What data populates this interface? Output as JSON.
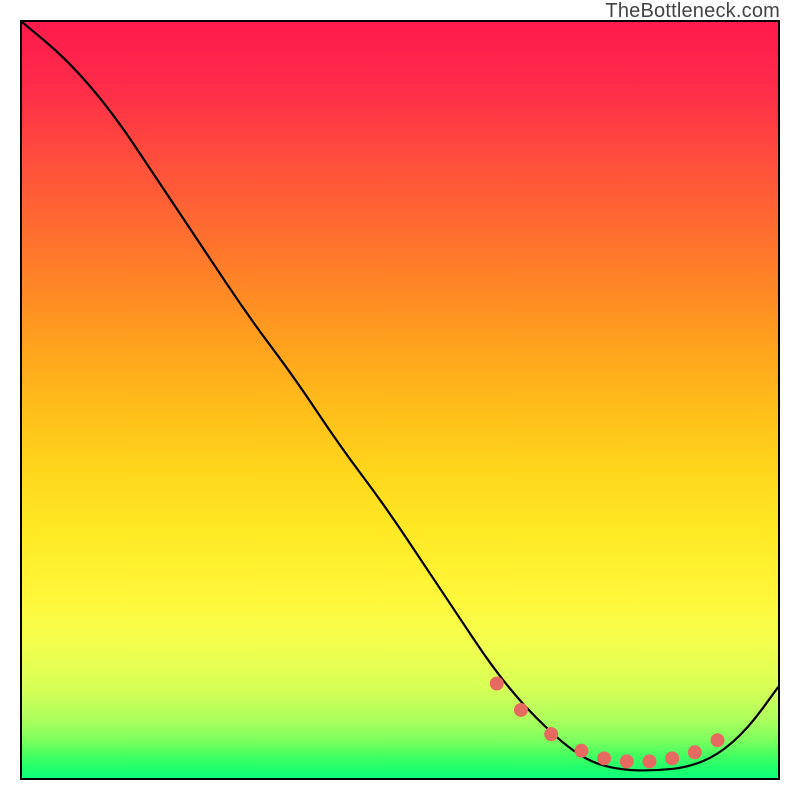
{
  "attribution": "TheBottleneck.com",
  "chart_data": {
    "type": "line",
    "title": "",
    "xlabel": "",
    "ylabel": "",
    "xlim_norm": [
      0,
      1
    ],
    "ylim": [
      0,
      100
    ],
    "series": [
      {
        "name": "curve",
        "x_norm": [
          0.0,
          0.06,
          0.12,
          0.18,
          0.24,
          0.3,
          0.36,
          0.42,
          0.48,
          0.54,
          0.58,
          0.62,
          0.66,
          0.7,
          0.73,
          0.76,
          0.8,
          0.84,
          0.88,
          0.92,
          0.96,
          1.0
        ],
        "y": [
          100,
          95,
          88,
          79,
          70,
          61,
          53,
          44,
          36,
          27,
          21,
          15,
          10,
          6,
          3.5,
          1.8,
          1,
          1,
          1.4,
          3.0,
          6.5,
          12
        ]
      },
      {
        "name": "markers",
        "x_norm": [
          0.628,
          0.66,
          0.7,
          0.74,
          0.77,
          0.8,
          0.83,
          0.86,
          0.89,
          0.92
        ],
        "y": [
          12.5,
          9.0,
          5.8,
          3.6,
          2.6,
          2.2,
          2.2,
          2.6,
          3.4,
          5.0
        ]
      }
    ],
    "marker_color": "#e66a5f",
    "line_color": "#000000"
  }
}
